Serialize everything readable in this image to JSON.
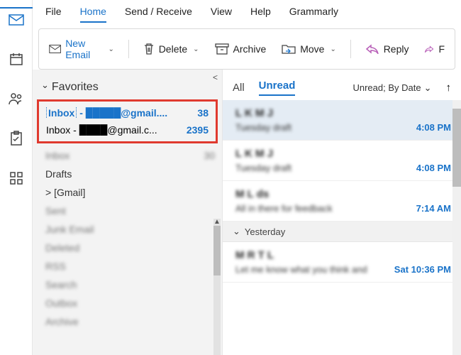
{
  "menubar": {
    "items": [
      "File",
      "Home",
      "Send / Receive",
      "View",
      "Help",
      "Grammarly"
    ],
    "active": 1
  },
  "ribbon": {
    "new_email": "New Email",
    "delete": "Delete",
    "archive": "Archive",
    "move": "Move",
    "reply": "Reply",
    "forward_initial": "F"
  },
  "nav": {
    "favorites_label": "Favorites",
    "inbox1": {
      "label": "Inbox",
      "account_fragment": "@gmail....",
      "count": "38"
    },
    "inbox2": {
      "label": "Inbox - ",
      "account_fragment": "@gmail.c...",
      "count": "2395"
    },
    "inbox3": {
      "label": "Inbox",
      "count": "30"
    },
    "drafts": "Drafts",
    "gmail_group": "[Gmail]",
    "blurs": [
      "Sent",
      "Junk Email",
      "Deleted",
      "RSS",
      "Search",
      "Outbox",
      "Archive"
    ]
  },
  "filter": {
    "all": "All",
    "unread": "Unread",
    "sort_label": "Unread; By Date",
    "chev": "⌄",
    "arrow": "↑"
  },
  "group_yesterday": "Yesterday",
  "msgs": [
    {
      "from": "L K M J",
      "preview": "Tuesday draft",
      "time": "4:08 PM"
    },
    {
      "from": "L K M J",
      "preview": "Tuesday draft",
      "time": "4:08 PM"
    },
    {
      "from": "M  L  ds",
      "preview": "All in there for feedback",
      "time": "7:14 AM"
    },
    {
      "from": "M R  T  L",
      "preview": "Let me know what you think and",
      "time": "Sat 10:36 PM"
    }
  ]
}
